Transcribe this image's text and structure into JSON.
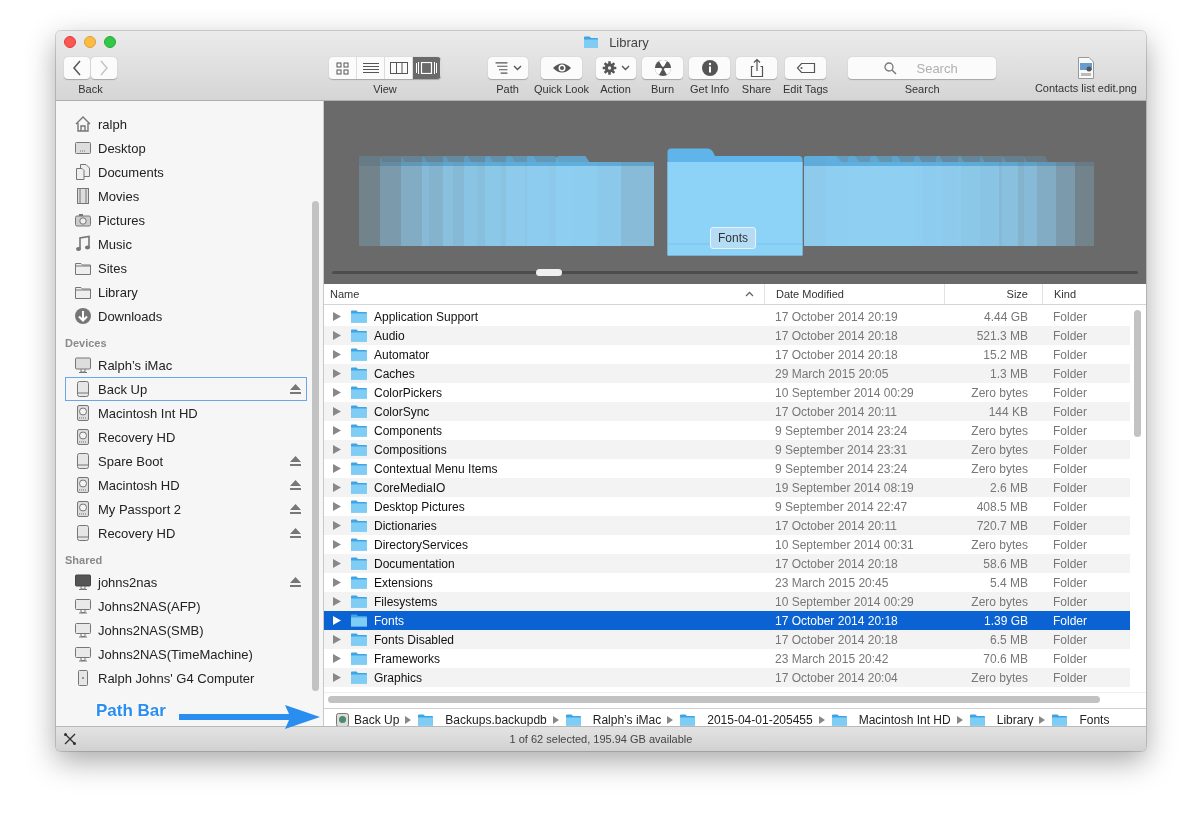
{
  "window": {
    "title": "Library"
  },
  "toolbar": {
    "nav": [
      {
        "kind": "back",
        "disabled": false
      },
      {
        "kind": "forward",
        "disabled": true
      }
    ],
    "nav_label": "Back",
    "view": {
      "label": "View",
      "modes": [
        {
          "kind": "icons",
          "selected": false
        },
        {
          "kind": "list",
          "selected": false
        },
        {
          "kind": "columns",
          "selected": false
        },
        {
          "kind": "coverflow",
          "selected": true
        }
      ]
    },
    "buttons": [
      {
        "kind": "path",
        "label": "Path",
        "menu": true
      },
      {
        "kind": "quicklook",
        "label": "Quick Look",
        "menu": false
      },
      {
        "kind": "action",
        "label": "Action",
        "menu": true
      },
      {
        "kind": "burn",
        "label": "Burn",
        "menu": false
      },
      {
        "kind": "info",
        "label": "Get Info",
        "menu": false
      },
      {
        "kind": "share",
        "label": "Share",
        "menu": false
      },
      {
        "kind": "tags",
        "label": "Edit Tags",
        "menu": false
      }
    ],
    "search": {
      "placeholder": "Search",
      "label": "Search"
    },
    "file": {
      "label": "Contacts list edit.png"
    }
  },
  "sidebar": {
    "sections": [
      {
        "items": [
          {
            "label": "ralph",
            "kind": "home",
            "ejectable": false,
            "selected": false
          },
          {
            "label": "Desktop",
            "kind": "desktop",
            "ejectable": false,
            "selected": false
          },
          {
            "label": "Documents",
            "kind": "documents",
            "ejectable": false,
            "selected": false
          },
          {
            "label": "Movies",
            "kind": "movies",
            "ejectable": false,
            "selected": false
          },
          {
            "label": "Pictures",
            "kind": "pictures",
            "ejectable": false,
            "selected": false
          },
          {
            "label": "Music",
            "kind": "music",
            "ejectable": false,
            "selected": false
          },
          {
            "label": "Sites",
            "kind": "folder",
            "ejectable": false,
            "selected": false
          },
          {
            "label": "Library",
            "kind": "folder",
            "ejectable": false,
            "selected": false
          },
          {
            "label": "Downloads",
            "kind": "downloads",
            "ejectable": false,
            "selected": false
          }
        ]
      },
      {
        "heading": "Devices",
        "items": [
          {
            "label": "Ralph’s iMac",
            "kind": "imac",
            "ejectable": false,
            "selected": false
          },
          {
            "label": "Back Up",
            "kind": "drive",
            "ejectable": true,
            "selected": true
          },
          {
            "label": "Macintosh Int HD",
            "kind": "hd",
            "ejectable": false,
            "selected": false
          },
          {
            "label": "Recovery HD",
            "kind": "hd",
            "ejectable": false,
            "selected": false
          },
          {
            "label": "Spare Boot",
            "kind": "drive",
            "ejectable": true,
            "selected": false
          },
          {
            "label": "Macintosh HD",
            "kind": "hd",
            "ejectable": true,
            "selected": false
          },
          {
            "label": "My Passport 2",
            "kind": "hd",
            "ejectable": true,
            "selected": false
          },
          {
            "label": "Recovery HD",
            "kind": "drive",
            "ejectable": true,
            "selected": false
          }
        ]
      },
      {
        "heading": "Shared",
        "items": [
          {
            "label": "johns2nas",
            "kind": "server",
            "ejectable": true,
            "selected": false
          },
          {
            "label": "Johns2NAS(AFP)",
            "kind": "display",
            "ejectable": false,
            "selected": false
          },
          {
            "label": "Johns2NAS(SMB)",
            "kind": "display",
            "ejectable": false,
            "selected": false
          },
          {
            "label": "Johns2NAS(TimeMachine)",
            "kind": "display",
            "ejectable": false,
            "selected": false
          },
          {
            "label": "Ralph Johns' G4 Computer",
            "kind": "tower",
            "ejectable": false,
            "selected": false
          }
        ]
      }
    ]
  },
  "cover_flow": {
    "caption": "Fonts"
  },
  "table": {
    "columns": [
      {
        "label": "Name",
        "sorted": true
      },
      {
        "label": "Date Modified",
        "sorted": false
      },
      {
        "label": "Size",
        "sorted": false
      },
      {
        "label": "Kind",
        "sorted": false
      }
    ],
    "rows": [
      {
        "name": "Application Support",
        "date": "17 October 2014 20:19",
        "size": "4.44 GB",
        "kind": "Folder",
        "selected": false
      },
      {
        "name": "Audio",
        "date": "17 October 2014 20:18",
        "size": "521.3 MB",
        "kind": "Folder",
        "selected": false
      },
      {
        "name": "Automator",
        "date": "17 October 2014 20:18",
        "size": "15.2 MB",
        "kind": "Folder",
        "selected": false
      },
      {
        "name": "Caches",
        "date": "29 March 2015 20:05",
        "size": "1.3 MB",
        "kind": "Folder",
        "selected": false
      },
      {
        "name": "ColorPickers",
        "date": "10 September 2014 00:29",
        "size": "Zero bytes",
        "kind": "Folder",
        "selected": false
      },
      {
        "name": "ColorSync",
        "date": "17 October 2014 20:11",
        "size": "144 KB",
        "kind": "Folder",
        "selected": false
      },
      {
        "name": "Components",
        "date": "9 September 2014 23:24",
        "size": "Zero bytes",
        "kind": "Folder",
        "selected": false
      },
      {
        "name": "Compositions",
        "date": "9 September 2014 23:31",
        "size": "Zero bytes",
        "kind": "Folder",
        "selected": false
      },
      {
        "name": "Contextual Menu Items",
        "date": "9 September 2014 23:24",
        "size": "Zero bytes",
        "kind": "Folder",
        "selected": false
      },
      {
        "name": "CoreMediaIO",
        "date": "19 September 2014 08:19",
        "size": "2.6 MB",
        "kind": "Folder",
        "selected": false
      },
      {
        "name": "Desktop Pictures",
        "date": "9 September 2014 22:47",
        "size": "408.5 MB",
        "kind": "Folder",
        "selected": false
      },
      {
        "name": "Dictionaries",
        "date": "17 October 2014 20:11",
        "size": "720.7 MB",
        "kind": "Folder",
        "selected": false
      },
      {
        "name": "DirectoryServices",
        "date": "10 September 2014 00:31",
        "size": "Zero bytes",
        "kind": "Folder",
        "selected": false
      },
      {
        "name": "Documentation",
        "date": "17 October 2014 20:18",
        "size": "58.6 MB",
        "kind": "Folder",
        "selected": false
      },
      {
        "name": "Extensions",
        "date": "23 March 2015 20:45",
        "size": "5.4 MB",
        "kind": "Folder",
        "selected": false
      },
      {
        "name": "Filesystems",
        "date": "10 September 2014 00:29",
        "size": "Zero bytes",
        "kind": "Folder",
        "selected": false
      },
      {
        "name": "Fonts",
        "date": "17 October 2014 20:18",
        "size": "1.39 GB",
        "kind": "Folder",
        "selected": true
      },
      {
        "name": "Fonts Disabled",
        "date": "17 October 2014 20:18",
        "size": "6.5 MB",
        "kind": "Folder",
        "selected": false
      },
      {
        "name": "Frameworks",
        "date": "23 March 2015 20:42",
        "size": "70.6 MB",
        "kind": "Folder",
        "selected": false
      },
      {
        "name": "Graphics",
        "date": "17 October 2014 20:04",
        "size": "Zero bytes",
        "kind": "Folder",
        "selected": false
      }
    ]
  },
  "path_bar": [
    {
      "label": "Back Up",
      "kind": "timemachine"
    },
    {
      "label": "Backups.backupdb",
      "kind": "folder"
    },
    {
      "label": "Ralph’s iMac",
      "kind": "folder"
    },
    {
      "label": "2015-04-01-205455",
      "kind": "folder"
    },
    {
      "label": "Macintosh Int HD",
      "kind": "folder"
    },
    {
      "label": "Library",
      "kind": "folder"
    },
    {
      "label": "Fonts",
      "kind": "folder"
    }
  ],
  "status_bar": "1 of 62 selected, 195.94 GB available",
  "annotation": {
    "text": "Path Bar"
  }
}
